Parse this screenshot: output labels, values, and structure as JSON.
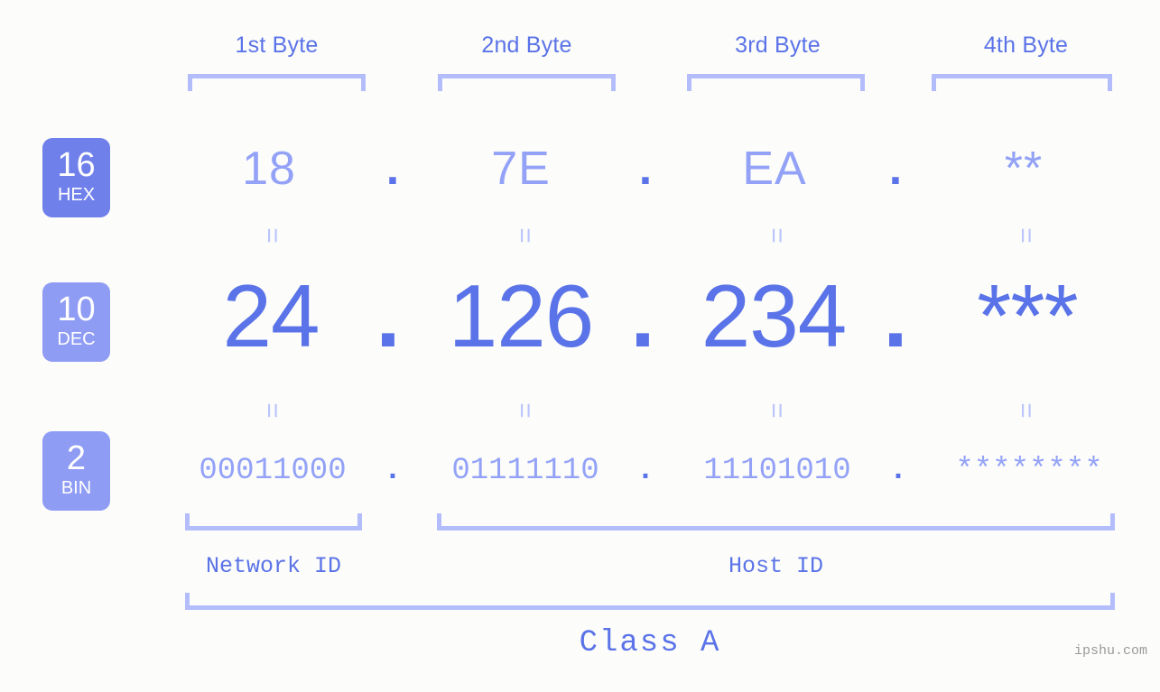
{
  "page": {
    "background": "#fcfdfa",
    "accent": "#5b73e8",
    "accent_light": "#93a2f7",
    "bracket_color": "#b4bdfb",
    "watermark": "ipshu.com"
  },
  "headers": {
    "bytes": [
      {
        "label": "1st Byte"
      },
      {
        "label": "2nd Byte"
      },
      {
        "label": "3rd Byte"
      },
      {
        "label": "4th Byte"
      }
    ]
  },
  "bases": [
    {
      "num": "16",
      "name": "HEX",
      "color": "#7080ea"
    },
    {
      "num": "10",
      "name": "DEC",
      "color": "#8f9cf4"
    },
    {
      "num": "2",
      "name": "BIN",
      "color": "#8f9cf4"
    }
  ],
  "rows": {
    "hex": {
      "values": [
        "18",
        "7E",
        "EA",
        "**"
      ],
      "separator": "."
    },
    "dec": {
      "values": [
        "24",
        "126",
        "234",
        "***"
      ],
      "separator": "."
    },
    "bin": {
      "values": [
        "00011000",
        "01111110",
        "11101010",
        "********"
      ],
      "separator": "."
    }
  },
  "equal_marks": {
    "glyph": "=",
    "count_per_row": 4
  },
  "footer": {
    "network_id_label": "Network ID",
    "host_id_label": "Host ID",
    "class_label": "Class A"
  }
}
